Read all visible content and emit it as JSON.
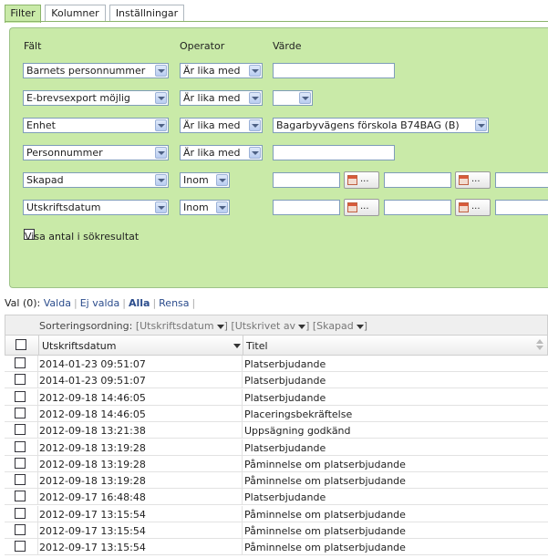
{
  "tabs": [
    "Filter",
    "Kolumner",
    "Inställningar"
  ],
  "headers": {
    "field": "Fält",
    "operator": "Operator",
    "value": "Värde"
  },
  "filters": [
    {
      "field": "Barnets personnummer",
      "operator": "Är lika med",
      "value": ""
    },
    {
      "field": "E-brevsexport möjlig",
      "operator": "Är lika med",
      "value": ""
    },
    {
      "field": "Enhet",
      "operator": "Är lika med",
      "value": "Bagarbyvägens förskola B74BAG (B)"
    },
    {
      "field": "Personnummer",
      "operator": "Är lika med",
      "value": ""
    },
    {
      "field": "Skapad",
      "operator": "Inom",
      "value": ""
    },
    {
      "field": "Utskriftsdatum",
      "operator": "Inom",
      "value": ""
    }
  ],
  "calendar_button": "...",
  "show_count_label": "Visa antal i sökresultat",
  "selection": {
    "count_label": "Val (0):",
    "selected": "Valda",
    "not_selected": "Ej valda",
    "all": "Alla",
    "clear": "Rensa"
  },
  "sort": {
    "label": "Sorteringsordning:",
    "options": [
      "[Utskriftsdatum",
      "] [Utskrivet av",
      "] [Skapad",
      "]"
    ]
  },
  "columns": [
    "Utskriftsdatum",
    "Titel"
  ],
  "rows": [
    {
      "date": "2014-01-23 09:51:07",
      "title": "Platserbjudande"
    },
    {
      "date": "2014-01-23 09:51:07",
      "title": "Platserbjudande"
    },
    {
      "date": "2012-09-18 14:46:05",
      "title": "Platserbjudande"
    },
    {
      "date": "2012-09-18 14:46:05",
      "title": "Placeringsbekräftelse"
    },
    {
      "date": "2012-09-18 13:21:38",
      "title": "Uppsägning godkänd"
    },
    {
      "date": "2012-09-18 13:19:28",
      "title": "Platserbjudande"
    },
    {
      "date": "2012-09-18 13:19:28",
      "title": "Påminnelse om platserbjudande"
    },
    {
      "date": "2012-09-18 13:19:28",
      "title": "Påminnelse om platserbjudande"
    },
    {
      "date": "2012-09-17 16:48:48",
      "title": "Platserbjudande"
    },
    {
      "date": "2012-09-17 13:15:54",
      "title": "Påminnelse om platserbjudande"
    },
    {
      "date": "2012-09-17 13:15:54",
      "title": "Påminnelse om platserbjudande"
    },
    {
      "date": "2012-09-17 13:15:54",
      "title": "Påminnelse om platserbjudande"
    }
  ]
}
